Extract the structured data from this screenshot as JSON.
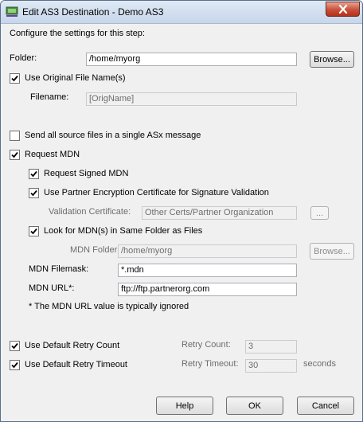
{
  "window": {
    "title": "Edit AS3 Destination - Demo AS3"
  },
  "intro": "Configure the settings for this step:",
  "folder": {
    "label": "Folder:",
    "value": "/home/myorg",
    "browse_label": "Browse..."
  },
  "use_original_file_name": {
    "label": "Use Original File Name(s)",
    "checked": true
  },
  "filename": {
    "label": "Filename:",
    "value": "[OrigName]"
  },
  "send_single_message": {
    "label": "Send all source files in a single ASx message",
    "checked": false
  },
  "request_mdn": {
    "label": "Request MDN",
    "checked": true
  },
  "request_signed_mdn": {
    "label": "Request Signed MDN",
    "checked": true
  },
  "use_partner_cert": {
    "label": "Use Partner Encryption Certificate for Signature Validation",
    "checked": true
  },
  "validation_certificate": {
    "label": "Validation Certificate:",
    "value": "Other Certs/Partner Organization",
    "button_label": "..."
  },
  "look_same_folder": {
    "label": "Look for MDN(s) in Same Folder as Files",
    "checked": true
  },
  "mdn_folder": {
    "label": "MDN Folder:",
    "value": "/home/myorg",
    "browse_label": "Browse..."
  },
  "mdn_filemask": {
    "label": "MDN Filemask:",
    "value": "*.mdn"
  },
  "mdn_url": {
    "label": "MDN URL*:",
    "value": "ftp://ftp.partnerorg.com"
  },
  "mdn_note": "* The MDN URL value is typically ignored",
  "retry_count": {
    "checkbox_label": "Use Default Retry Count",
    "checked": true,
    "label": "Retry Count:",
    "value": "3"
  },
  "retry_timeout": {
    "checkbox_label": "Use Default Retry Timeout",
    "checked": true,
    "label": "Retry Timeout:",
    "value": "30",
    "unit": "seconds"
  },
  "buttons": {
    "help": "Help",
    "ok": "OK",
    "cancel": "Cancel"
  }
}
